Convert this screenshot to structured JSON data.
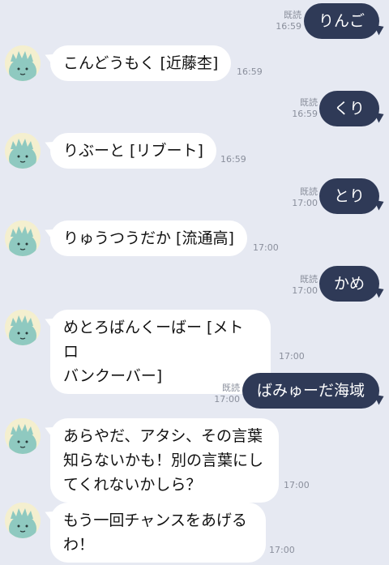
{
  "messages": [
    {
      "dir": "out",
      "text": "りんご",
      "read": "既読",
      "time": "16:59"
    },
    {
      "dir": "in",
      "text": "こんどうもく [近藤杢]",
      "time": "16:59"
    },
    {
      "dir": "out",
      "text": "くり",
      "read": "既読",
      "time": "16:59"
    },
    {
      "dir": "in",
      "text": "りぶーと [リブート]",
      "time": "16:59"
    },
    {
      "dir": "out",
      "text": "とり",
      "read": "既読",
      "time": "17:00"
    },
    {
      "dir": "in",
      "text": "りゅうつうだか [流通高]",
      "time": "17:00"
    },
    {
      "dir": "out",
      "text": "かめ",
      "read": "既読",
      "time": "17:00"
    },
    {
      "dir": "in",
      "text": "めとろばんくーばー [メトロ\nバンクーバー]",
      "time": "17:00"
    },
    {
      "dir": "out",
      "text": "ばみゅーだ海域",
      "read": "既読",
      "time": "17:00"
    },
    {
      "dir": "in",
      "text": "あらやだ、アタシ、その言葉\n知らないかも！別の言葉にし\nてくれないかしら？",
      "time": "17:00"
    },
    {
      "dir": "in",
      "text": "もう一回チャンスをあげる\nわ！",
      "time": "17:00"
    }
  ],
  "avatar_icon": "statue-of-liberty-icon"
}
